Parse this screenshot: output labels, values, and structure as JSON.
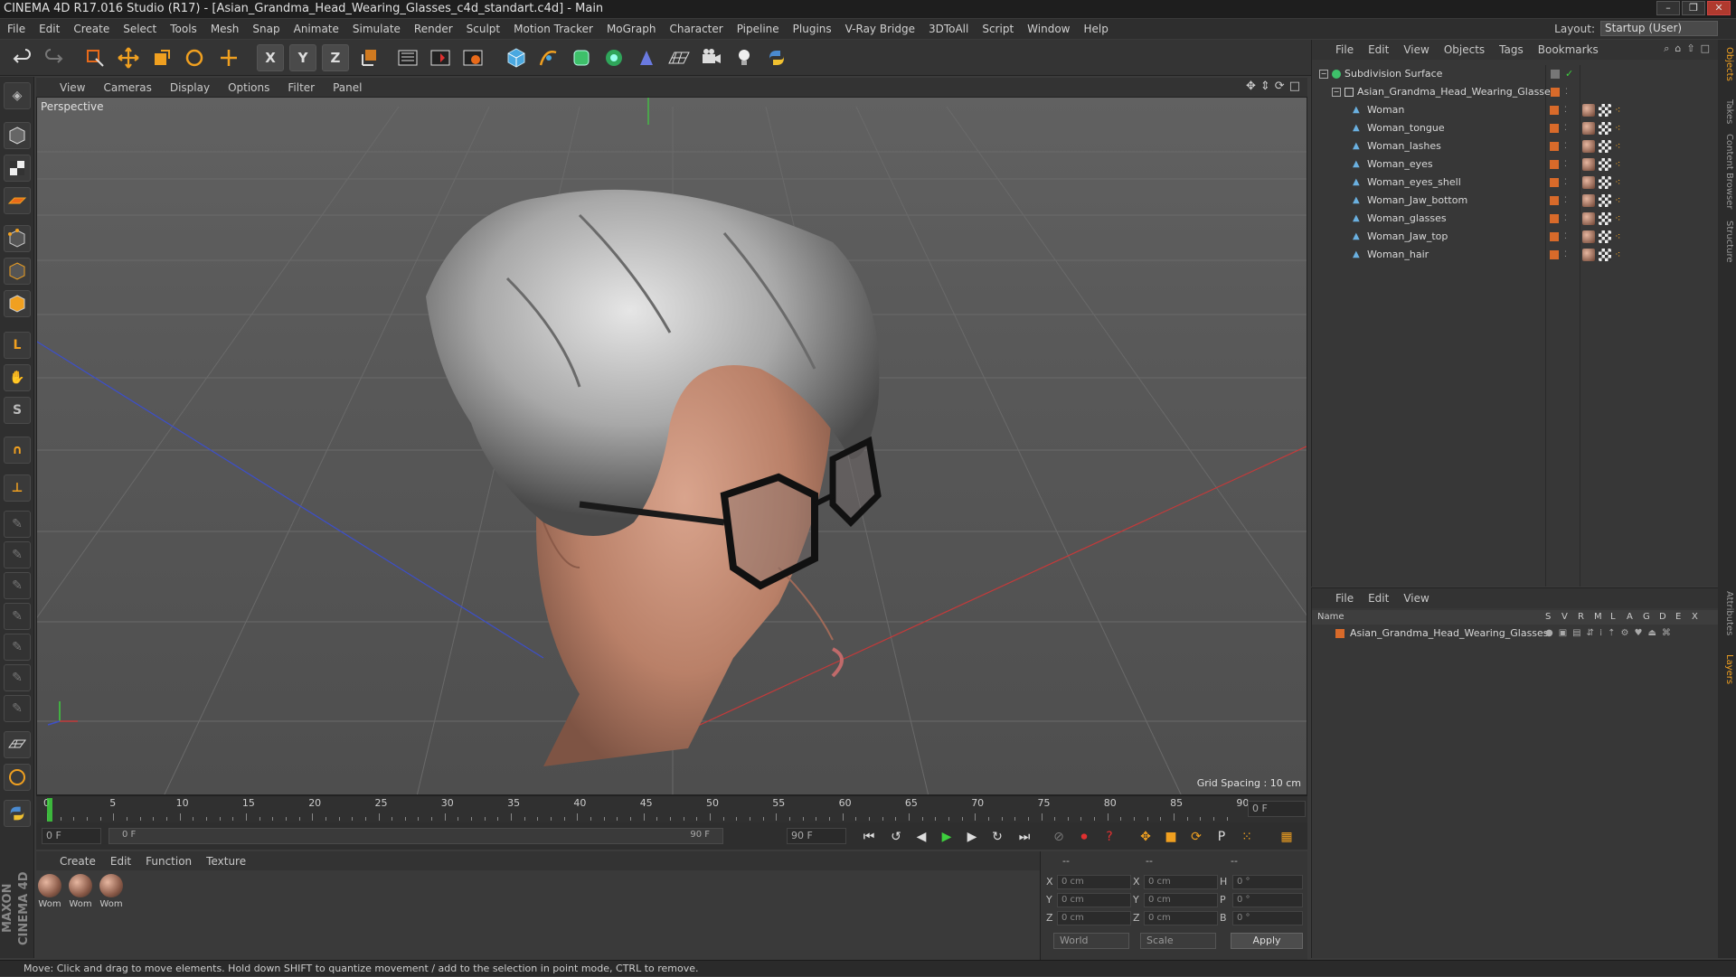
{
  "window": {
    "title": "CINEMA 4D R17.016 Studio (R17) - [Asian_Grandma_Head_Wearing_Glasses_c4d_standart.c4d] - Main",
    "minimize": "–",
    "restore": "❐",
    "close": "✕"
  },
  "menubar": {
    "items": [
      "File",
      "Edit",
      "Create",
      "Select",
      "Tools",
      "Mesh",
      "Snap",
      "Animate",
      "Simulate",
      "Render",
      "Sculpt",
      "Motion Tracker",
      "MoGraph",
      "Character",
      "Pipeline",
      "Plugins",
      "V-Ray Bridge",
      "3DToAll",
      "Script",
      "Window",
      "Help"
    ],
    "layout_label": "Layout:",
    "layout_value": "Startup (User)"
  },
  "toolbar": {
    "x_label": "X",
    "y_label": "Y",
    "z_label": "Z"
  },
  "viewport": {
    "menu": [
      "View",
      "Cameras",
      "Display",
      "Options",
      "Filter",
      "Panel"
    ],
    "label": "Perspective",
    "grid_spacing": "Grid Spacing : 10 cm"
  },
  "timeline": {
    "ticks": [
      "0",
      "5",
      "10",
      "15",
      "20",
      "25",
      "30",
      "35",
      "40",
      "45",
      "50",
      "55",
      "60",
      "65",
      "70",
      "75",
      "80",
      "85",
      "90"
    ],
    "current_frame": "0 F",
    "start_field": "0 F",
    "range_start": "0 F",
    "range_end": "90 F",
    "end_field": "90 F"
  },
  "materials": {
    "menu": [
      "Create",
      "Edit",
      "Function",
      "Texture"
    ],
    "items": [
      "Wom",
      "Wom",
      "Wom"
    ]
  },
  "coords": {
    "header": [
      "--",
      "--",
      "--"
    ],
    "rows": [
      {
        "a": "X",
        "av": "0 cm",
        "b": "X",
        "bv": "0 cm",
        "c": "H",
        "cv": "0 °"
      },
      {
        "a": "Y",
        "av": "0 cm",
        "b": "Y",
        "bv": "0 cm",
        "c": "P",
        "cv": "0 °"
      },
      {
        "a": "Z",
        "av": "0 cm",
        "b": "Z",
        "bv": "0 cm",
        "c": "B",
        "cv": "0 °"
      }
    ],
    "mode": "World",
    "type": "Scale",
    "apply": "Apply"
  },
  "objects": {
    "menu": [
      "File",
      "Edit",
      "View",
      "Objects",
      "Tags",
      "Bookmarks"
    ],
    "rows": [
      {
        "name": "Subdivision Surface",
        "indent": 0
      },
      {
        "name": "Asian_Grandma_Head_Wearing_Glasses",
        "indent": 1
      },
      {
        "name": "Woman",
        "indent": 2
      },
      {
        "name": "Woman_tongue",
        "indent": 2
      },
      {
        "name": "Woman_lashes",
        "indent": 2
      },
      {
        "name": "Woman_eyes",
        "indent": 2
      },
      {
        "name": "Woman_eyes_shell",
        "indent": 2
      },
      {
        "name": "Woman_Jaw_bottom",
        "indent": 2
      },
      {
        "name": "Woman_glasses",
        "indent": 2
      },
      {
        "name": "Woman_Jaw_top",
        "indent": 2
      },
      {
        "name": "Woman_hair",
        "indent": 2
      }
    ]
  },
  "layers": {
    "menu": [
      "File",
      "Edit",
      "View"
    ],
    "columns": {
      "name": "Name",
      "flags": [
        "S",
        "V",
        "R",
        "M",
        "L",
        "A",
        "G",
        "D",
        "E",
        "X"
      ]
    },
    "rows": [
      {
        "name": "Asian_Grandma_Head_Wearing_Glasses"
      }
    ]
  },
  "sidetabs": [
    "Objects",
    "Takes",
    "Content Browser",
    "Structure",
    "Attributes",
    "Layers"
  ],
  "status": "Move: Click and drag to move elements. Hold down SHIFT to quantize movement / add to the selection in point mode, CTRL to remove.",
  "colors": {
    "accent": "#e86a1a",
    "layer_orange": "#d86a2a",
    "green_check": "#3ecf3e"
  }
}
